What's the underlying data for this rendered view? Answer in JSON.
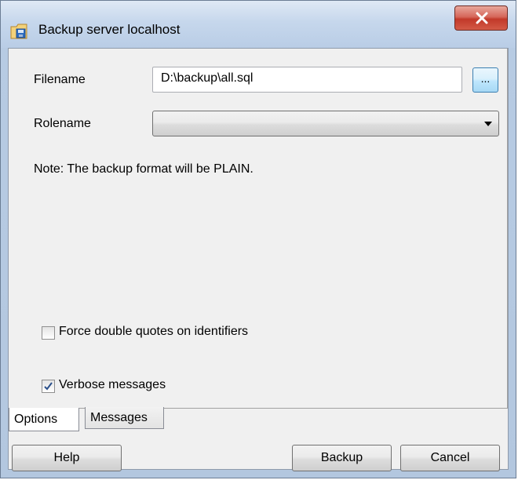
{
  "window": {
    "title": "Backup server localhost",
    "icon": "backup-server-icon",
    "close_icon": "close-x-icon"
  },
  "form": {
    "filename_label": "Filename",
    "filename_value": "D:\\backup\\all.sql",
    "browse_label": "...",
    "rolename_label": "Rolename",
    "rolename_value": "",
    "note": "Note: The backup format will be PLAIN.",
    "force_quotes_label": "Force double quotes on identifiers",
    "force_quotes_checked": false,
    "verbose_label": "Verbose messages",
    "verbose_checked": true
  },
  "tabs": [
    {
      "label": "Options",
      "active": true
    },
    {
      "label": "Messages",
      "active": false
    }
  ],
  "buttons": {
    "help": "Help",
    "backup": "Backup",
    "cancel": "Cancel"
  },
  "colors": {
    "close_button": "#c2392a",
    "titlebar": "#c6d7ec",
    "panel_bg": "#f0f0f0"
  }
}
